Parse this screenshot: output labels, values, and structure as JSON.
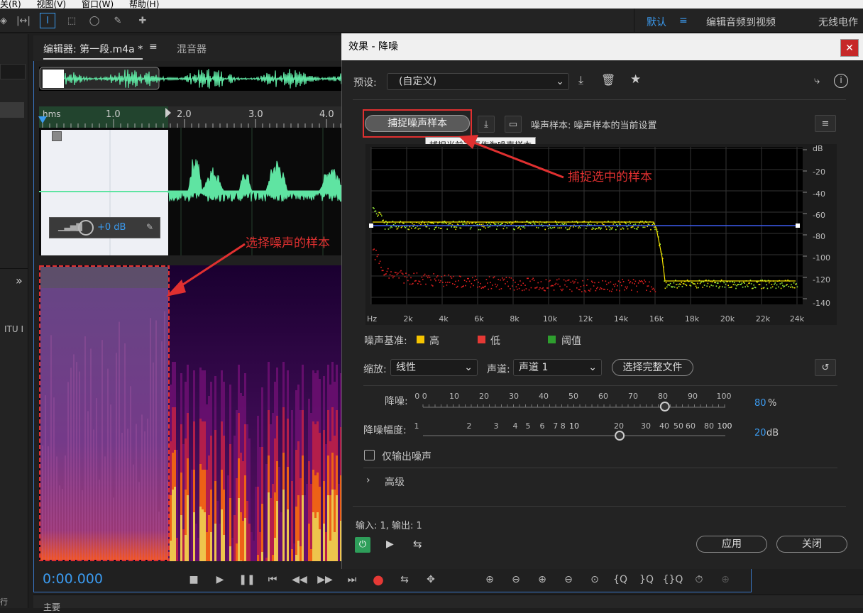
{
  "menubar": {
    "items": [
      "关(R)",
      "视图(V)",
      "窗口(W)",
      "帮助(H)"
    ]
  },
  "workspace": {
    "tabs": [
      "默认",
      "编辑音频到视频",
      "无线电作"
    ]
  },
  "editor": {
    "tab_editor": "编辑器: 第一段.m4a *",
    "tab_mixer": "混音器",
    "ruler_labels": [
      "hms",
      "1.0",
      "2.0",
      "3.0",
      "4.0"
    ],
    "gain_value": "+0 dB",
    "timecode": "0:00.000"
  },
  "left_panel": {
    "label": "ITU I",
    "bottom_label": "行"
  },
  "bottom_panel": {
    "label": "主要"
  },
  "dialog": {
    "title": "效果 - 降噪",
    "preset_label": "预设:",
    "preset_value": "(自定义)",
    "capture_button": "捕捉噪声样本",
    "noise_sample_label": "噪声样本: 噪声样本的当前设置",
    "tooltip": "捕捉当前选区作为噪声样本",
    "graph_y_labels": [
      "dB",
      "-20",
      "-40",
      "-60",
      "-80",
      "-100",
      "-120",
      "-140"
    ],
    "graph_x_labels": [
      "Hz",
      "2k",
      "4k",
      "6k",
      "8k",
      "10k",
      "12k",
      "14k",
      "16k",
      "18k",
      "20k",
      "22k",
      "24k"
    ],
    "legend_title": "噪声基准:",
    "legend": [
      {
        "label": "高",
        "color": "#f5c400"
      },
      {
        "label": "低",
        "color": "#e53935"
      },
      {
        "label": "阈值",
        "color": "#2e9e2e"
      }
    ],
    "scale_label": "缩放:",
    "scale_value": "线性",
    "channel_label": "声道:",
    "channel_value": "声道 1",
    "select_full_file": "选择完整文件",
    "reduction_label": "降噪:",
    "reduction_ticks": [
      "0 0",
      "10",
      "20",
      "30",
      "40",
      "50",
      "60",
      "70",
      "80",
      "90",
      "100"
    ],
    "reduction_value": "80",
    "reduction_unit": "%",
    "reduce_by_label": "降噪幅度:",
    "reduce_by_ticks": [
      "1",
      "2",
      "3",
      "4",
      "5",
      "6",
      "7 8",
      "10",
      "20",
      "30",
      "40",
      "50",
      "60",
      "80",
      "100"
    ],
    "reduce_by_value": "20",
    "reduce_by_unit": "dB",
    "output_noise_only": "仅输出噪声",
    "advanced": "高级",
    "io_label": "输入: 1, 输出: 1",
    "apply_button": "应用",
    "close_button": "关闭"
  },
  "annotations": {
    "capture_note": "捕捉选中的样本",
    "select_note": "选择噪声的样本"
  },
  "colors": {
    "accent": "#3b9bf0",
    "annotation_red": "#e03030",
    "spectrum_green": "#9bf53c"
  }
}
